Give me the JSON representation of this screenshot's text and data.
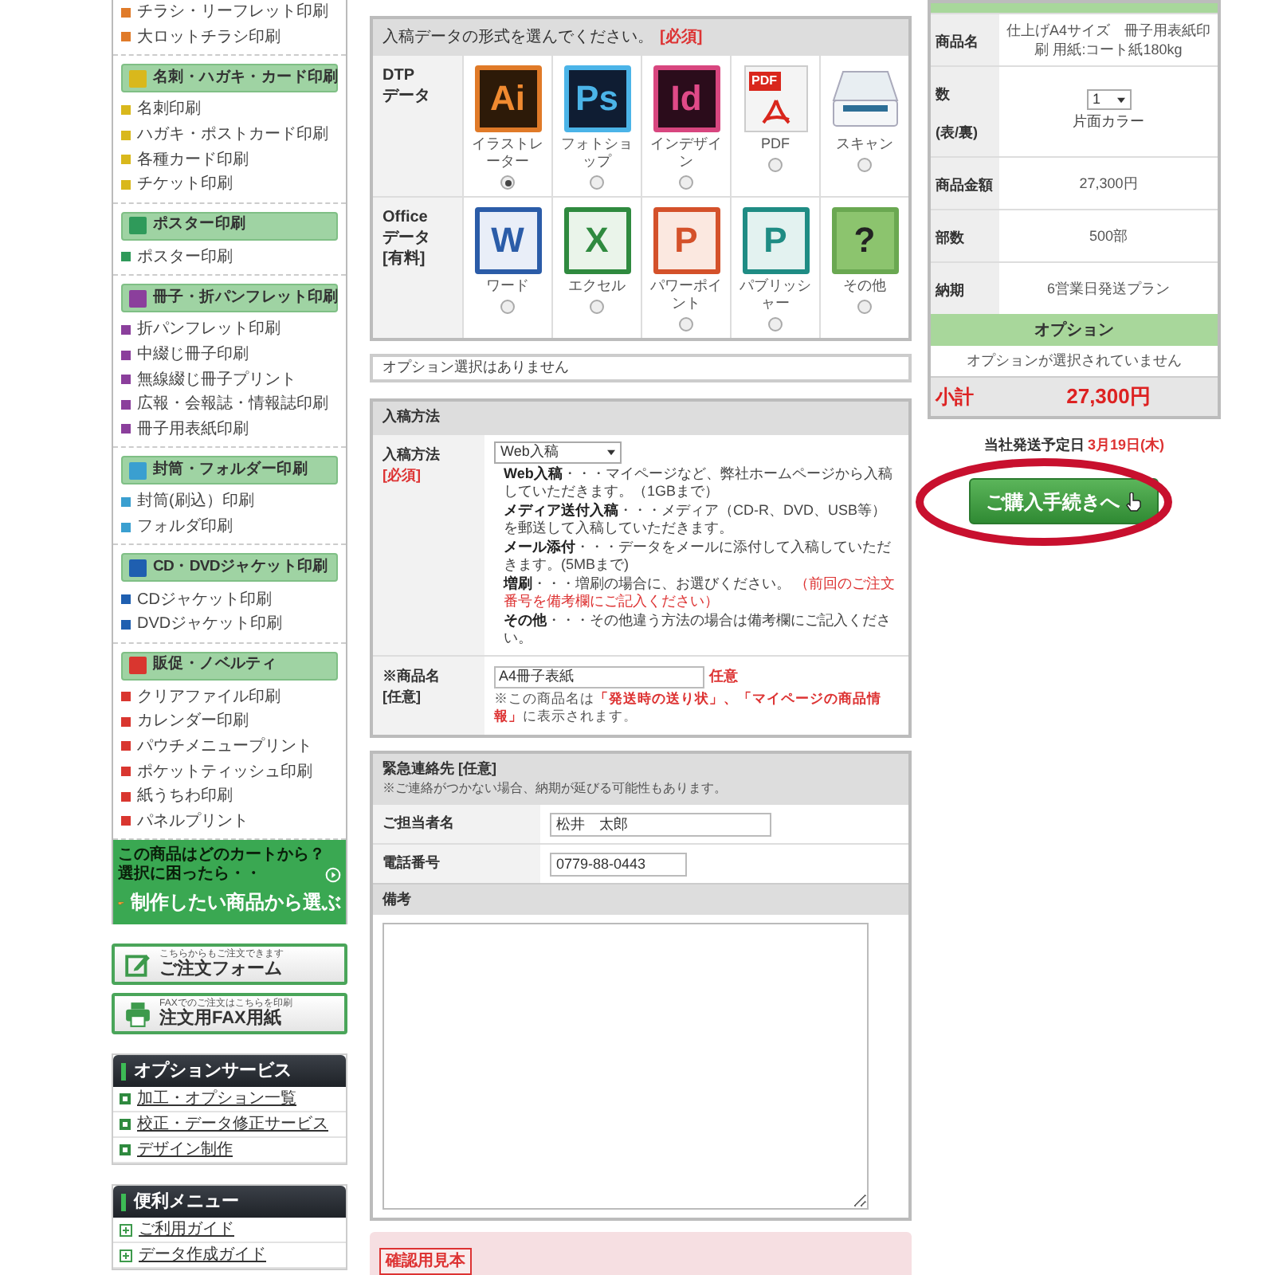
{
  "sidebar": {
    "categories": [
      {
        "color": "#e07b2a",
        "items": [
          "チラシ・リーフレット印刷",
          "大ロットチラシ印刷"
        ]
      },
      {
        "title": "名刺・ハガキ・カード印刷",
        "color": "#d9b81c",
        "items": [
          "名刺印刷",
          "ハガキ・ポストカード印刷",
          "各種カード印刷",
          "チケット印刷"
        ]
      },
      {
        "title": "ポスター印刷",
        "color": "#2f9a5a",
        "items": [
          "ポスター印刷"
        ]
      },
      {
        "title": "冊子・折パンフレット印刷",
        "color": "#8b3f9c",
        "items": [
          "折パンフレット印刷",
          "中綴じ冊子印刷",
          "無線綴じ冊子プリント",
          "広報・会報誌・情報誌印刷",
          "冊子用表紙印刷"
        ]
      },
      {
        "title": "封筒・フォルダー印刷",
        "color": "#3a9fd0",
        "items": [
          "封筒(刷込）印刷",
          "フォルダ印刷"
        ]
      },
      {
        "title": "CD・DVDジャケット印刷",
        "color": "#1f5fb0",
        "items": [
          "CDジャケット印刷",
          "DVDジャケット印刷"
        ]
      },
      {
        "title": "販促・ノベルティ",
        "color": "#d9362f",
        "items": [
          "クリアファイル印刷",
          "カレンダー印刷",
          "パウチメニュープリント",
          "ポケットティッシュ印刷",
          "紙うちわ印刷",
          "パネルプリント"
        ]
      }
    ],
    "promo": {
      "lines": [
        "この商品はどのカートから？",
        "選択に困ったら・・"
      ],
      "cta": "制作したい商品から選ぶ"
    },
    "order_buttons": [
      {
        "kind": "form",
        "caption": "こちらからもご注文できます",
        "label": "ご注文フォーム"
      },
      {
        "kind": "fax",
        "caption": "FAXでのご注文はこちらを印刷",
        "label": "注文用FAX用紙"
      }
    ],
    "menus": [
      {
        "kind": "bullet",
        "title": "オプションサービス",
        "links": [
          "加工・オプション一覧",
          "校正・データ修正サービス",
          "デザイン制作"
        ]
      },
      {
        "kind": "plus",
        "title": "便利メニュー",
        "links": [
          "ご利用ガイド",
          "データ作成ガイド"
        ]
      }
    ]
  },
  "main": {
    "format_table": {
      "prompt": "入稿データの形式を選んでください。",
      "required": "[必須]",
      "rows": [
        {
          "label": "DTP\nデータ",
          "options": [
            {
              "kind": "ai",
              "badge": "Ai",
              "label": "イラストレーター",
              "selected": true
            },
            {
              "kind": "ps",
              "badge": "Ps",
              "label": "フォトショップ",
              "selected": false
            },
            {
              "kind": "id",
              "badge": "Id",
              "label": "インデザイン",
              "selected": false
            },
            {
              "kind": "pdf",
              "badge": "PDF",
              "label": "PDF",
              "selected": false
            },
            {
              "kind": "scanner",
              "label": "スキャン",
              "selected": false
            }
          ]
        },
        {
          "label": "Office\nデータ\n[有料]",
          "options": [
            {
              "kind": "word",
              "badge": "W",
              "label": "ワード",
              "selected": false
            },
            {
              "kind": "excel",
              "badge": "X",
              "label": "エクセル",
              "selected": false
            },
            {
              "kind": "powerpoint",
              "badge": "P",
              "label": "パワーポイント",
              "selected": false
            },
            {
              "kind": "publisher",
              "badge": "P",
              "label": "パブリッシャー",
              "selected": false
            },
            {
              "kind": "other",
              "badge": "?",
              "label": "その他",
              "selected": false
            }
          ]
        }
      ]
    },
    "option_notice": "オプション選択はありません",
    "submission": {
      "title": "入稿方法",
      "method_label": "入稿方法",
      "method_required": "[必須]",
      "method_value": "Web入稿",
      "descriptions": [
        {
          "text": "**Web入稿**・・・マイページなど、弊社ホームページから入稿していただきます。（1GBまで）"
        },
        {
          "text": "**メディア送付入稿**・・・メディア（CD-R、DVD、USB等）を郵送して入稿していただきます。"
        },
        {
          "text": "**メール添付**・・・データをメールに添付して入稿していただきます。(5MBまで)"
        },
        {
          "text": "**増刷**・・・増刷の場合に、お選びください。",
          "note": "（前回のご注文番号を備考欄にご記入ください）"
        },
        {
          "text": "**その他**・・・その他違う方法の場合は備考欄にご記入ください。"
        }
      ],
      "name_label": "※商品名",
      "name_optional": "[任意]",
      "name_value": "A4冊子表紙",
      "name_tag": "任意",
      "name_hint": "※この商品名は**「発送時の送り状」、「マイページの商品情報」**に表示されます。"
    },
    "contact": {
      "title": "緊急連絡先 [任意]",
      "note": "※ご連絡がつかない場合、納期が延びる可能性もあります。",
      "fields": [
        {
          "label": "ご担当者名",
          "value": "松井　太郎"
        },
        {
          "label": "電話番号",
          "value": "0779-88-0443"
        }
      ],
      "remarks_label": "備考"
    },
    "sample_title": "確認用見本"
  },
  "cart": {
    "rows": [
      {
        "kind": "text",
        "label": "商品名",
        "value": "仕上げA4サイズ　冊子用表紙印刷 用紙:コート紙180kg"
      },
      {
        "kind": "select",
        "label": "数\n(表/裏)",
        "value": "1",
        "sub": "片面カラー"
      },
      {
        "kind": "text",
        "label": "商品金額",
        "value": "27,300円"
      },
      {
        "kind": "text",
        "label": "部数",
        "value": "500部"
      },
      {
        "kind": "text",
        "label": "納期",
        "value": "6営業日発送プラン"
      }
    ],
    "option_title": "オプション",
    "option_value": "オプションが選択されていません",
    "subtotal_label": "小計",
    "subtotal_value": "27,300円",
    "ship_label": "当社発送予定日",
    "ship_date": "3月19日(木)",
    "checkout": "ご購入手続きへ"
  }
}
